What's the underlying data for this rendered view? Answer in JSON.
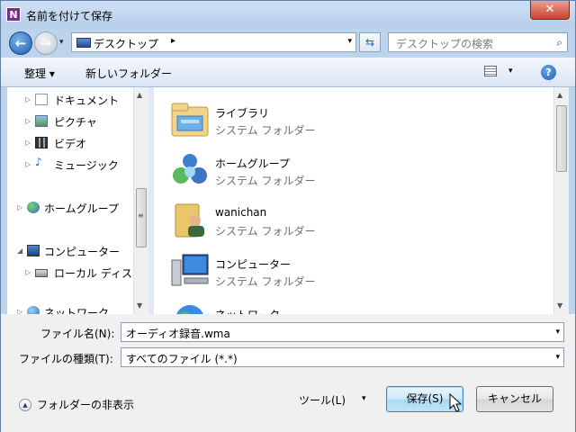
{
  "window": {
    "title": "名前を付けて保存",
    "app_icon_letter": "N",
    "close_glyph": "✕"
  },
  "navigation": {
    "back_glyph": "←",
    "forward_glyph": "→",
    "history_glyph": "▾",
    "address_text": "デスクトップ",
    "address_sep": "▸",
    "address_dropdown": "▾",
    "refresh_glyph": "⇆",
    "search_placeholder": "デスクトップの検索",
    "search_icon": "⌕"
  },
  "toolbar": {
    "organize_label": "整理 ▾",
    "new_folder_label": "新しいフォルダー",
    "view_dropdown": "▾",
    "help_glyph": "?"
  },
  "nav_pane": {
    "items": [
      {
        "label": "ドキュメント",
        "icon": "documents-icon"
      },
      {
        "label": "ピクチャ",
        "icon": "pictures-icon"
      },
      {
        "label": "ビデオ",
        "icon": "videos-icon"
      },
      {
        "label": "ミュージック",
        "icon": "music-icon"
      },
      {
        "label": "ホームグループ",
        "icon": "homegroup-icon"
      },
      {
        "label": "コンピューター",
        "icon": "computer-icon"
      },
      {
        "label": "ローカル ディス",
        "icon": "local-disk-icon"
      },
      {
        "label": "ネットワーク",
        "icon": "network-icon"
      }
    ],
    "collapsed_glyph": "▷",
    "expanded_glyph": "◢"
  },
  "file_list": {
    "items": [
      {
        "name": "ライブラリ",
        "type": "システム フォルダー",
        "icon": "libraries-icon"
      },
      {
        "name": "ホームグループ",
        "type": "システム フォルダー",
        "icon": "homegroup-icon"
      },
      {
        "name": "wanichan",
        "type": "システム フォルダー",
        "icon": "user-folder-icon"
      },
      {
        "name": "コンピューター",
        "type": "システム フォルダー",
        "icon": "computer-icon"
      },
      {
        "name": "ネットワーク",
        "type": "",
        "icon": "network-icon"
      }
    ]
  },
  "scrollbar": {
    "up": "▲",
    "down": "▼",
    "grip": "≡"
  },
  "form": {
    "filename_label": "ファイル名(N):",
    "filename_value": "オーディオ録音.wma",
    "filetype_label": "ファイルの種類(T):",
    "filetype_value": "すべてのファイル (*.*)",
    "dropdown_glyph": "▾"
  },
  "footer": {
    "hide_folders_glyph": "▲",
    "hide_folders_label": "フォルダーの非表示",
    "tools_label": "ツール(L)",
    "tools_dropdown": "▾",
    "save_label": "保存(S)",
    "cancel_label": "キャンセル"
  },
  "colors": {
    "frame": "#bcd3ec",
    "accent": "#1c5fb3",
    "close": "#c8432d"
  }
}
